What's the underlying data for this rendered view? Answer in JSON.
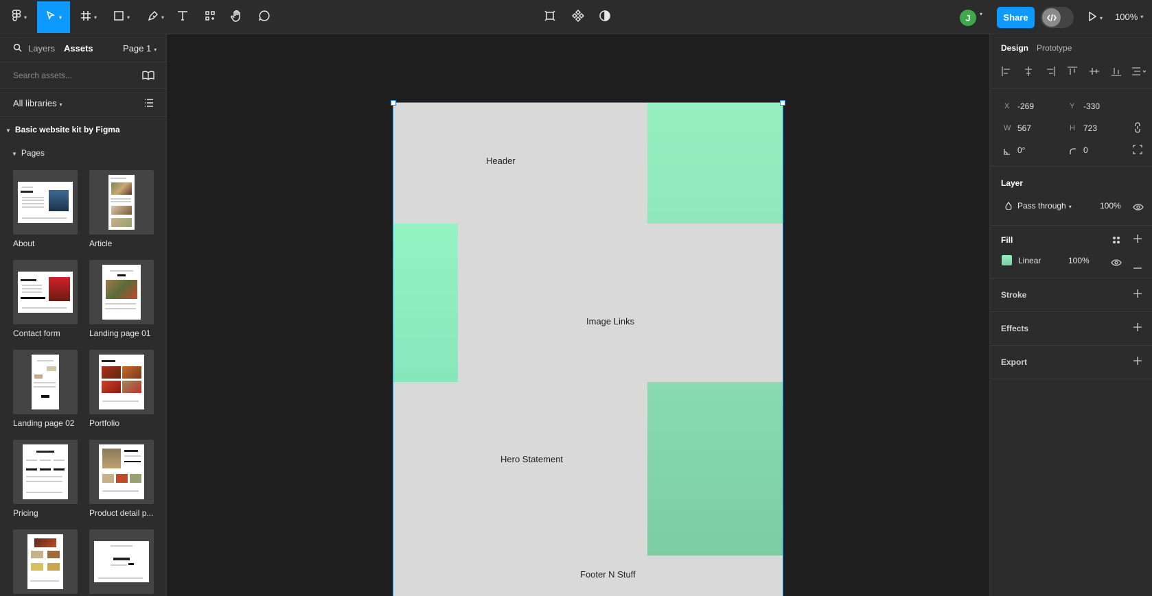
{
  "toolbar": {
    "tools": [
      "main-menu",
      "move",
      "frame",
      "shape",
      "pen",
      "text",
      "resources",
      "hand",
      "comment"
    ],
    "center_tools": [
      "component-frame",
      "component",
      "contrast"
    ],
    "avatar_initial": "J",
    "share_label": "Share",
    "zoom": "100%",
    "accent": "#0d99ff"
  },
  "left_panel": {
    "tab_layers": "Layers",
    "tab_assets": "Assets",
    "page_select": "Page 1",
    "search_placeholder": "Search assets...",
    "library_select": "All libraries",
    "library_title": "Basic website kit by Figma",
    "group_title": "Pages",
    "assets": [
      {
        "label": "About"
      },
      {
        "label": "Article"
      },
      {
        "label": "Contact form"
      },
      {
        "label": "Landing page 01"
      },
      {
        "label": "Landing page 02"
      },
      {
        "label": "Portfolio"
      },
      {
        "label": "Pricing"
      },
      {
        "label": "Product detail p..."
      },
      {
        "label": ""
      },
      {
        "label": ""
      }
    ]
  },
  "canvas": {
    "frame_texts": {
      "header": "Header",
      "image_links": "Image Links",
      "hero": "Hero Statement",
      "footer": "Footer N Stuff"
    },
    "frame_background": "#d9d9d9",
    "green_accent": "#95efc0"
  },
  "right_panel": {
    "tab_design": "Design",
    "tab_prototype": "Prototype",
    "x_label": "X",
    "x": "-269",
    "y_label": "Y",
    "y": "-330",
    "w_label": "W",
    "w": "567",
    "h_label": "H",
    "h": "723",
    "rotation": "0°",
    "radius": "0",
    "layer_title": "Layer",
    "blend_mode": "Pass through",
    "layer_opacity": "100%",
    "fill_title": "Fill",
    "fill_type": "Linear",
    "fill_opacity": "100%",
    "stroke_title": "Stroke",
    "effects_title": "Effects",
    "export_title": "Export"
  }
}
